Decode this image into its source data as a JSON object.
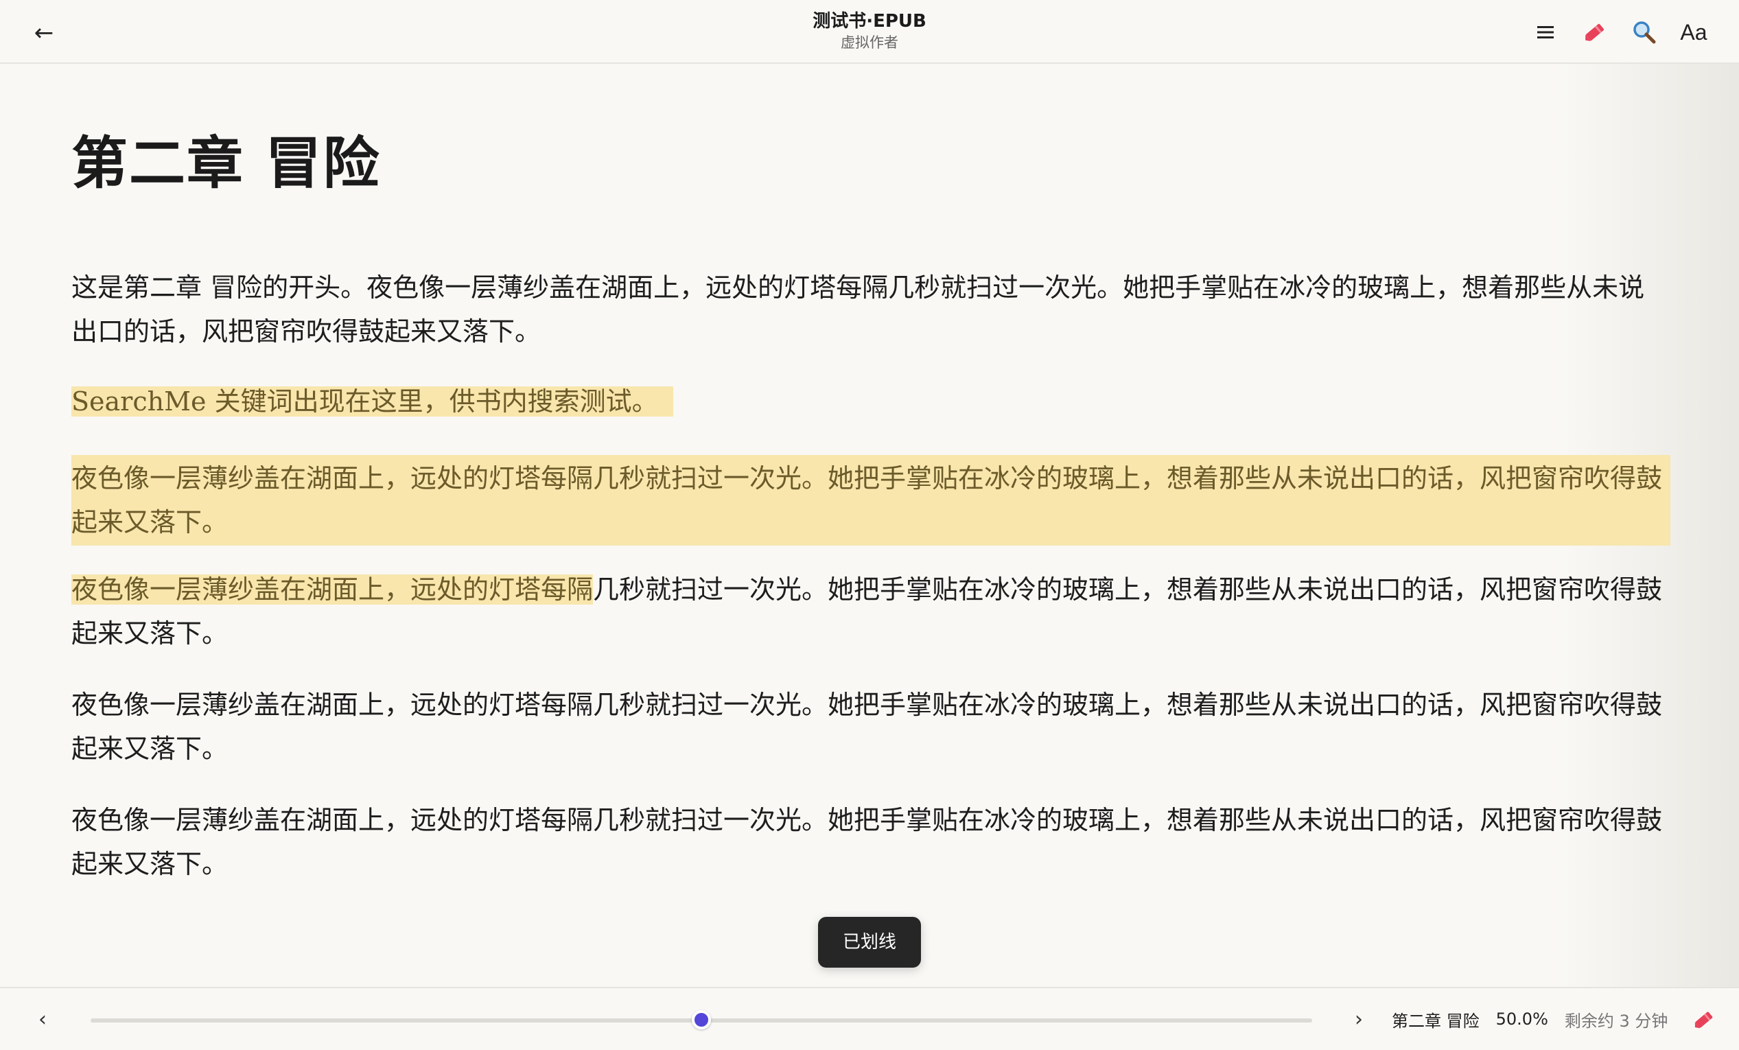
{
  "header": {
    "back_label": "←",
    "book_title": "测试书·EPUB",
    "author": "虚拟作者",
    "font_settings_label": "Aa"
  },
  "icons": {
    "back": "arrow-left-icon",
    "toc": "menu-icon",
    "highlight": "highlighter-icon",
    "search": "search-icon",
    "font": "font-settings-icon"
  },
  "colors": {
    "highlight": "#f8e6ac",
    "accent": "#5346d8",
    "marker": "#e8425a"
  },
  "chapter": {
    "title": "第二章 冒险",
    "p1": "这是第二章 冒险的开头。夜色像一层薄纱盖在湖面上，远处的灯塔每隔几秒就扫过一次光。她把手掌贴在冰冷的玻璃上，想着那些从未说出口的话，风把窗帘吹得鼓起来又落下。",
    "p2": "SearchMe 关键词出现在这里，供书内搜索测试。",
    "p3": "夜色像一层薄纱盖在湖面上，远处的灯塔每隔几秒就扫过一次光。她把手掌贴在冰冷的玻璃上，想着那些从未说出口的话，风把窗帘吹得鼓起来又落下。",
    "p4_highlighted": "夜色像一层薄纱盖在湖面上，远处的灯塔每隔",
    "p4_rest": "几秒就扫过一次光。她把手掌贴在冰冷的玻璃上，想着那些从未说出口的话，风把窗帘吹得鼓起来又落下。",
    "p5": "夜色像一层薄纱盖在湖面上，远处的灯塔每隔几秒就扫过一次光。她把手掌贴在冰冷的玻璃上，想着那些从未说出口的话，风把窗帘吹得鼓起来又落下。",
    "p6": "夜色像一层薄纱盖在湖面上，远处的灯塔每隔几秒就扫过一次光。她把手掌贴在冰冷的玻璃上，想着那些从未说出口的话，风把窗帘吹得鼓起来又落下。"
  },
  "toast": {
    "text": "已划线"
  },
  "footer": {
    "prev_label": "‹",
    "next_label": "›",
    "chapter_name": "第二章 冒险",
    "progress_text": "50.0%",
    "progress_value": 0.5,
    "remaining": "剩余约 3 分钟"
  }
}
